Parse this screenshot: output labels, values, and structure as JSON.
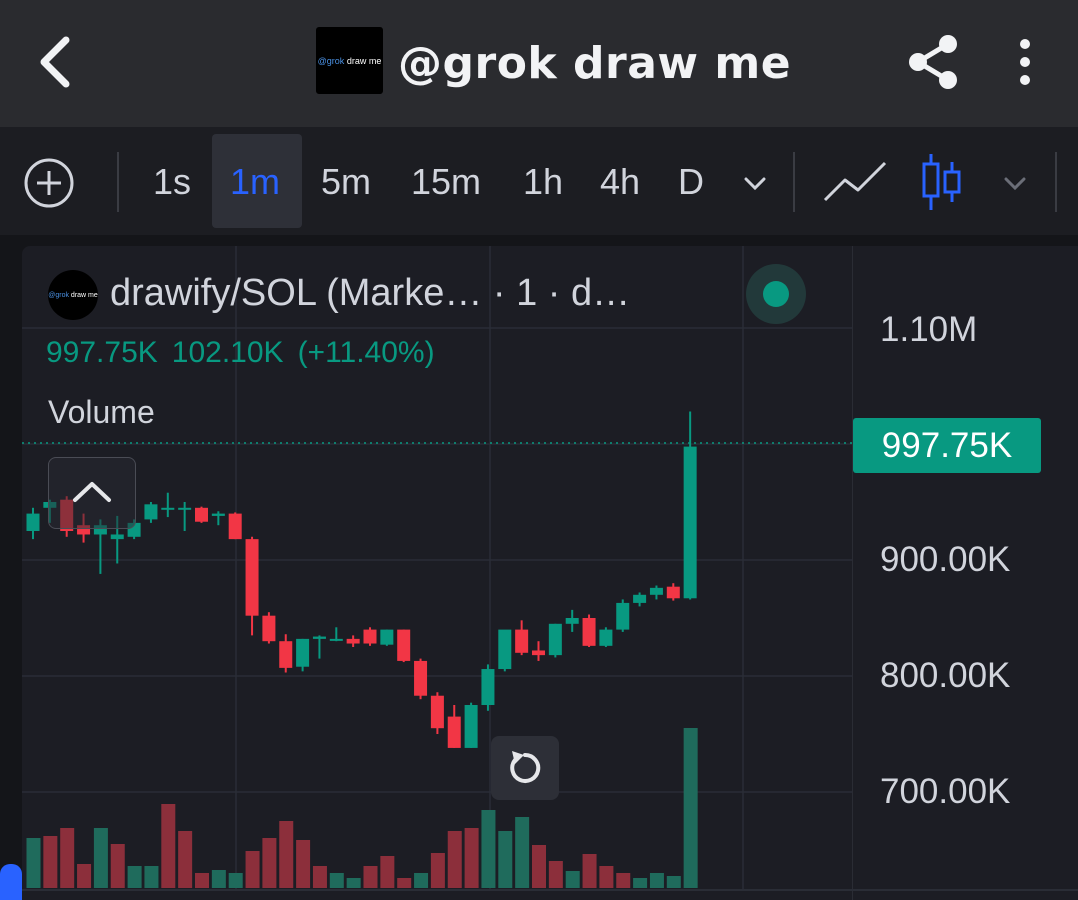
{
  "header": {
    "title": "@grok draw me",
    "logo_text_a": "@grok",
    "logo_text_b": "draw me"
  },
  "toolbar": {
    "intervals": [
      "1s",
      "1m",
      "5m",
      "15m",
      "1h",
      "4h",
      "D"
    ],
    "active_interval": "1m"
  },
  "legend": {
    "symbol": "drawify/SOL (Marke…  · 1 · d…",
    "last": "997.75K",
    "change": "102.10K",
    "change_pct": "(+11.40%)",
    "volume_label": "Volume"
  },
  "price_scale": {
    "labels": [
      "1.10M",
      "900.00K",
      "800.00K",
      "700.00K"
    ],
    "last_price_label": "997.75K"
  },
  "colors": {
    "up": "#089981",
    "down": "#f23645",
    "accent": "#2962ff",
    "vol_up": "#1f6b5c",
    "vol_down": "#8c2f3b"
  },
  "chart_data": {
    "type": "candlestick",
    "ylim": [
      650000,
      1150000
    ],
    "candles": [
      {
        "o": 925000,
        "h": 945000,
        "l": 918000,
        "c": 940000
      },
      {
        "o": 945000,
        "h": 952000,
        "l": 932000,
        "c": 950000
      },
      {
        "o": 952000,
        "h": 955000,
        "l": 920000,
        "c": 925000
      },
      {
        "o": 930000,
        "h": 940000,
        "l": 915000,
        "c": 922000
      },
      {
        "o": 922000,
        "h": 935000,
        "l": 888000,
        "c": 930000
      },
      {
        "o": 918000,
        "h": 938000,
        "l": 897000,
        "c": 922000
      },
      {
        "o": 920000,
        "h": 935000,
        "l": 918000,
        "c": 932000
      },
      {
        "o": 935000,
        "h": 950000,
        "l": 932000,
        "c": 948000
      },
      {
        "o": 945000,
        "h": 958000,
        "l": 937000,
        "c": 945000
      },
      {
        "o": 945000,
        "h": 950000,
        "l": 925000,
        "c": 945000
      },
      {
        "o": 945000,
        "h": 946000,
        "l": 932000,
        "c": 933000
      },
      {
        "o": 938000,
        "h": 942000,
        "l": 930000,
        "c": 940000
      },
      {
        "o": 940000,
        "h": 941000,
        "l": 918000,
        "c": 918000
      },
      {
        "o": 918000,
        "h": 920000,
        "l": 835000,
        "c": 852000
      },
      {
        "o": 852000,
        "h": 855000,
        "l": 828000,
        "c": 830000
      },
      {
        "o": 830000,
        "h": 836000,
        "l": 803000,
        "c": 807000
      },
      {
        "o": 808000,
        "h": 832000,
        "l": 804000,
        "c": 832000
      },
      {
        "o": 832000,
        "h": 835000,
        "l": 815000,
        "c": 834000
      },
      {
        "o": 832000,
        "h": 842000,
        "l": 830000,
        "c": 832000
      },
      {
        "o": 832000,
        "h": 835000,
        "l": 825000,
        "c": 828000
      },
      {
        "o": 840000,
        "h": 842000,
        "l": 826000,
        "c": 828000
      },
      {
        "o": 827000,
        "h": 840000,
        "l": 826000,
        "c": 840000
      },
      {
        "o": 840000,
        "h": 840000,
        "l": 812000,
        "c": 813000
      },
      {
        "o": 813000,
        "h": 815000,
        "l": 780000,
        "c": 783000
      },
      {
        "o": 783000,
        "h": 786000,
        "l": 750000,
        "c": 755000
      },
      {
        "o": 765000,
        "h": 775000,
        "l": 738000,
        "c": 738000
      },
      {
        "o": 738000,
        "h": 777000,
        "l": 738000,
        "c": 775000
      },
      {
        "o": 775000,
        "h": 810000,
        "l": 770000,
        "c": 806000
      },
      {
        "o": 806000,
        "h": 835000,
        "l": 804000,
        "c": 840000
      },
      {
        "o": 840000,
        "h": 848000,
        "l": 818000,
        "c": 820000
      },
      {
        "o": 822000,
        "h": 830000,
        "l": 813000,
        "c": 818000
      },
      {
        "o": 818000,
        "h": 845000,
        "l": 816000,
        "c": 845000
      },
      {
        "o": 845000,
        "h": 857000,
        "l": 838000,
        "c": 850000
      },
      {
        "o": 850000,
        "h": 853000,
        "l": 825000,
        "c": 826000
      },
      {
        "o": 826000,
        "h": 842000,
        "l": 825000,
        "c": 840000
      },
      {
        "o": 840000,
        "h": 866000,
        "l": 838000,
        "c": 863000
      },
      {
        "o": 863000,
        "h": 872000,
        "l": 860000,
        "c": 870000
      },
      {
        "o": 870000,
        "h": 878000,
        "l": 866000,
        "c": 876000
      },
      {
        "o": 877000,
        "h": 880000,
        "l": 865000,
        "c": 867000
      },
      {
        "o": 867000,
        "h": 1028000,
        "l": 866000,
        "c": 997750
      }
    ],
    "volumes": [
      {
        "v": 50,
        "up": true
      },
      {
        "v": 52,
        "up": false
      },
      {
        "v": 60,
        "up": false
      },
      {
        "v": 24,
        "up": false
      },
      {
        "v": 60,
        "up": true
      },
      {
        "v": 44,
        "up": false
      },
      {
        "v": 22,
        "up": true
      },
      {
        "v": 22,
        "up": true
      },
      {
        "v": 84,
        "up": false
      },
      {
        "v": 57,
        "up": false
      },
      {
        "v": 15,
        "up": false
      },
      {
        "v": 18,
        "up": true
      },
      {
        "v": 15,
        "up": true
      },
      {
        "v": 37,
        "up": false
      },
      {
        "v": 50,
        "up": false
      },
      {
        "v": 67,
        "up": false
      },
      {
        "v": 48,
        "up": false
      },
      {
        "v": 22,
        "up": false
      },
      {
        "v": 15,
        "up": true
      },
      {
        "v": 10,
        "up": true
      },
      {
        "v": 22,
        "up": false
      },
      {
        "v": 32,
        "up": false
      },
      {
        "v": 10,
        "up": false
      },
      {
        "v": 15,
        "up": true
      },
      {
        "v": 35,
        "up": false
      },
      {
        "v": 57,
        "up": false
      },
      {
        "v": 60,
        "up": false
      },
      {
        "v": 78,
        "up": true
      },
      {
        "v": 57,
        "up": true
      },
      {
        "v": 71,
        "up": true
      },
      {
        "v": 43,
        "up": false
      },
      {
        "v": 27,
        "up": false
      },
      {
        "v": 17,
        "up": true
      },
      {
        "v": 34,
        "up": false
      },
      {
        "v": 22,
        "up": false
      },
      {
        "v": 15,
        "up": false
      },
      {
        "v": 10,
        "up": true
      },
      {
        "v": 15,
        "up": true
      },
      {
        "v": 12,
        "up": true
      },
      {
        "v": 160,
        "up": true
      }
    ]
  }
}
